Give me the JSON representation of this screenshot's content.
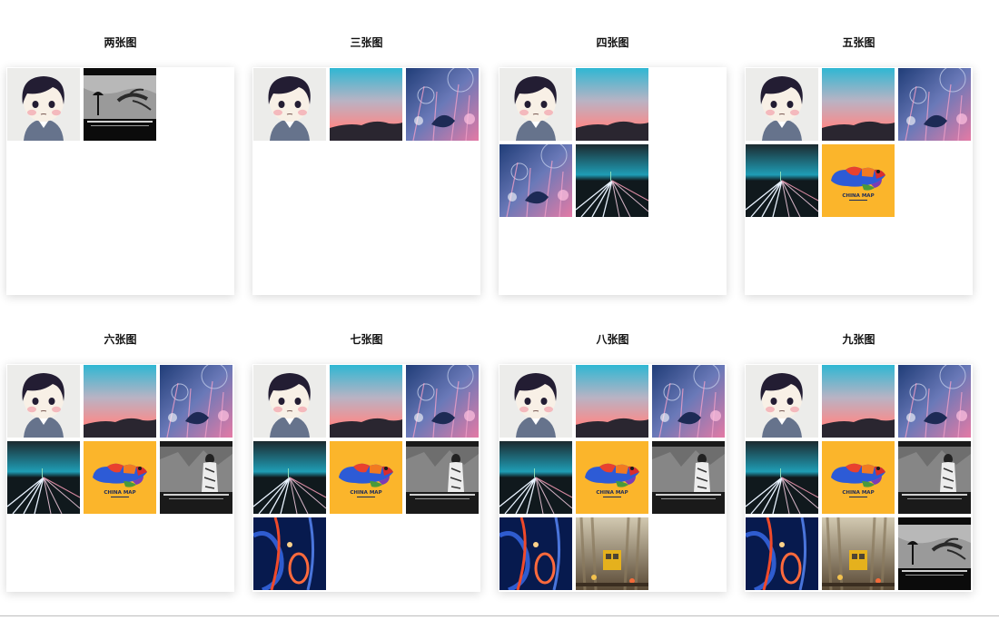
{
  "groups": [
    {
      "title": "两张图",
      "images": [
        "avatar-cartoon",
        "tree-bw"
      ]
    },
    {
      "title": "三张图",
      "images": [
        "avatar-cartoon",
        "sunset-gradient",
        "anime-flowers"
      ]
    },
    {
      "title": "四张图",
      "images": [
        "avatar-cartoon",
        "sunset-gradient",
        "anime-flowers",
        "night-road"
      ]
    },
    {
      "title": "五张图",
      "images": [
        "avatar-cartoon",
        "sunset-gradient",
        "anime-flowers",
        "night-road",
        "china-map"
      ]
    },
    {
      "title": "六张图",
      "images": [
        "avatar-cartoon",
        "sunset-gradient",
        "anime-flowers",
        "night-road",
        "china-map",
        "girl-bw"
      ]
    },
    {
      "title": "七张图",
      "images": [
        "avatar-cartoon",
        "sunset-gradient",
        "anime-flowers",
        "night-road",
        "china-map",
        "girl-bw",
        "neon-lights"
      ]
    },
    {
      "title": "八张图",
      "images": [
        "avatar-cartoon",
        "sunset-gradient",
        "anime-flowers",
        "night-road",
        "china-map",
        "girl-bw",
        "neon-lights",
        "rain-street"
      ]
    },
    {
      "title": "九张图",
      "images": [
        "avatar-cartoon",
        "sunset-gradient",
        "anime-flowers",
        "night-road",
        "china-map",
        "girl-bw",
        "neon-lights",
        "rain-street",
        "tree-bw"
      ]
    }
  ],
  "image_text": {
    "china-map": "CHINA MAP"
  }
}
